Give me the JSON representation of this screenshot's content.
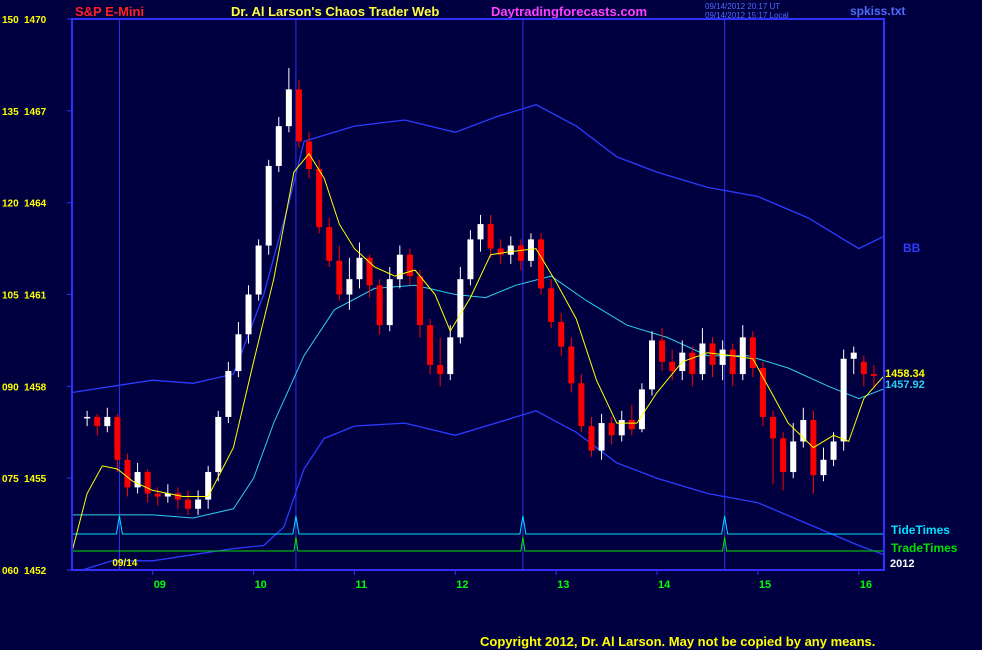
{
  "header": {
    "symbol": "S&P E-Mini",
    "title": "Dr. Al Larson's Chaos Trader Web",
    "site": "Daytradingforecasts.com",
    "timestamp_utc": "09/14/2012 20:17 UT",
    "timestamp_local": "09/14/2012 15:17 Local",
    "file": "spkiss.txt"
  },
  "footer": {
    "copyright": "Copyright 2012, Dr. Al Larson. May not be copied by any means."
  },
  "colors": {
    "background": "#000040",
    "frame": "#3030ff",
    "up_candle": "#ffffff",
    "down_candle": "#ff0000",
    "band": "#2a3cff",
    "mid": "#2ad0f0",
    "fast": "#ffff00",
    "tide": "#00e0ff",
    "trade": "#00e000",
    "time_label": "#00ff00"
  },
  "chart_data": {
    "type": "candlestick",
    "ylim": [
      1452,
      1470
    ],
    "xlim": [
      8.2,
      16.25
    ],
    "y_ticks": [
      {
        "left": "060",
        "value": 1452
      },
      {
        "left": "075",
        "value": 1455
      },
      {
        "left": "090",
        "value": 1458
      },
      {
        "left": "105",
        "value": 1461
      },
      {
        "left": "120",
        "value": 1464
      },
      {
        "left": "135",
        "value": 1467
      },
      {
        "left": "150",
        "value": 1470
      }
    ],
    "x_ticks": [
      {
        "label": "09",
        "x": 9
      },
      {
        "label": "10",
        "x": 10
      },
      {
        "label": "11",
        "x": 11
      },
      {
        "label": "12",
        "x": 12
      },
      {
        "label": "13",
        "x": 13
      },
      {
        "label": "14",
        "x": 14
      },
      {
        "label": "15",
        "x": 15
      },
      {
        "label": "16",
        "x": 16
      }
    ],
    "date_label": "09/14",
    "date_label_x": 8.6,
    "year_label": "2012",
    "vertical_lines": [
      8.67,
      10.42,
      12.67,
      14.67
    ],
    "tide_times": {
      "label": "TideTimes",
      "spikes": [
        8.67,
        10.42,
        12.67,
        14.67
      ]
    },
    "trade_times": {
      "label": "TradeTimes",
      "spikes": [
        10.42,
        12.67,
        14.67
      ]
    },
    "band_label": "BB",
    "last_values": [
      {
        "value": 1458.34,
        "label": "1458.34",
        "series": "fast"
      },
      {
        "value": 1457.92,
        "label": "1457.92",
        "series": "mid"
      }
    ],
    "candles": [
      [
        8.35,
        1457.0,
        1457.0,
        1457.2,
        1456.7
      ],
      [
        8.45,
        1457.0,
        1456.7,
        1457.1,
        1456.4
      ],
      [
        8.55,
        1456.7,
        1457.0,
        1457.3,
        1456.5
      ],
      [
        8.65,
        1457.0,
        1455.6,
        1457.1,
        1455.2
      ],
      [
        8.75,
        1455.6,
        1454.7,
        1455.8,
        1454.4
      ],
      [
        8.85,
        1454.7,
        1455.2,
        1455.5,
        1454.5
      ],
      [
        8.95,
        1455.2,
        1454.5,
        1455.3,
        1454.2
      ],
      [
        9.05,
        1454.5,
        1454.4,
        1454.7,
        1454.1
      ],
      [
        9.15,
        1454.4,
        1454.5,
        1454.8,
        1454.2
      ],
      [
        9.25,
        1454.5,
        1454.3,
        1454.7,
        1454.0
      ],
      [
        9.35,
        1454.3,
        1454.0,
        1454.6,
        1453.8
      ],
      [
        9.45,
        1454.0,
        1454.3,
        1454.6,
        1453.8
      ],
      [
        9.55,
        1454.3,
        1455.2,
        1455.4,
        1454.0
      ],
      [
        9.65,
        1455.2,
        1457.0,
        1457.2,
        1454.9
      ],
      [
        9.75,
        1457.0,
        1458.5,
        1458.8,
        1456.8
      ],
      [
        9.85,
        1458.5,
        1459.7,
        1460.1,
        1458.3
      ],
      [
        9.95,
        1459.7,
        1461.0,
        1461.3,
        1459.4
      ],
      [
        10.05,
        1461.0,
        1462.6,
        1462.8,
        1460.8
      ],
      [
        10.15,
        1462.6,
        1465.2,
        1465.4,
        1462.3
      ],
      [
        10.25,
        1465.2,
        1466.5,
        1466.8,
        1465.0
      ],
      [
        10.35,
        1466.5,
        1467.7,
        1468.4,
        1466.3
      ],
      [
        10.45,
        1467.7,
        1466.0,
        1468.0,
        1465.8
      ],
      [
        10.55,
        1466.0,
        1465.1,
        1466.3,
        1464.8
      ],
      [
        10.65,
        1465.1,
        1463.2,
        1465.4,
        1463.0
      ],
      [
        10.75,
        1463.2,
        1462.1,
        1463.5,
        1461.9
      ],
      [
        10.85,
        1462.1,
        1461.0,
        1462.6,
        1460.8
      ],
      [
        10.95,
        1461.0,
        1461.5,
        1462.2,
        1460.5
      ],
      [
        11.05,
        1461.5,
        1462.2,
        1462.7,
        1461.2
      ],
      [
        11.15,
        1462.2,
        1461.3,
        1462.3,
        1460.9
      ],
      [
        11.25,
        1461.3,
        1460.0,
        1461.5,
        1459.7
      ],
      [
        11.35,
        1460.0,
        1461.5,
        1461.9,
        1459.8
      ],
      [
        11.45,
        1461.5,
        1462.3,
        1462.6,
        1461.2
      ],
      [
        11.55,
        1462.3,
        1461.6,
        1462.5,
        1461.3
      ],
      [
        11.65,
        1461.6,
        1460.0,
        1461.8,
        1459.6
      ],
      [
        11.75,
        1460.0,
        1458.7,
        1460.2,
        1458.4
      ],
      [
        11.85,
        1458.7,
        1458.4,
        1459.6,
        1458.0
      ],
      [
        11.95,
        1458.4,
        1459.6,
        1460.0,
        1458.2
      ],
      [
        12.05,
        1459.6,
        1461.5,
        1461.9,
        1459.4
      ],
      [
        12.15,
        1461.5,
        1462.8,
        1463.1,
        1461.3
      ],
      [
        12.25,
        1462.8,
        1463.3,
        1463.6,
        1462.4
      ],
      [
        12.35,
        1463.3,
        1462.5,
        1463.6,
        1462.2
      ],
      [
        12.45,
        1462.5,
        1462.3,
        1462.8,
        1462.0
      ],
      [
        12.55,
        1462.3,
        1462.6,
        1462.9,
        1462.0
      ],
      [
        12.65,
        1462.6,
        1462.1,
        1462.8,
        1461.8
      ],
      [
        12.75,
        1462.1,
        1462.8,
        1463.0,
        1461.9
      ],
      [
        12.85,
        1462.8,
        1461.2,
        1463.0,
        1461.0
      ],
      [
        12.95,
        1461.2,
        1460.1,
        1461.5,
        1459.9
      ],
      [
        13.05,
        1460.1,
        1459.3,
        1460.4,
        1459.0
      ],
      [
        13.15,
        1459.3,
        1458.1,
        1459.6,
        1457.8
      ],
      [
        13.25,
        1458.1,
        1456.7,
        1458.4,
        1456.5
      ],
      [
        13.35,
        1456.7,
        1455.9,
        1457.0,
        1455.7
      ],
      [
        13.45,
        1455.9,
        1456.8,
        1457.1,
        1455.6
      ],
      [
        13.55,
        1456.8,
        1456.4,
        1457.0,
        1456.1
      ],
      [
        13.65,
        1456.4,
        1456.9,
        1457.2,
        1456.2
      ],
      [
        13.75,
        1456.9,
        1456.6,
        1457.4,
        1456.4
      ],
      [
        13.85,
        1456.6,
        1457.9,
        1458.1,
        1456.5
      ],
      [
        13.95,
        1457.9,
        1459.5,
        1459.8,
        1457.7
      ],
      [
        14.05,
        1459.5,
        1458.8,
        1459.9,
        1458.5
      ],
      [
        14.15,
        1458.8,
        1458.5,
        1459.2,
        1458.2
      ],
      [
        14.25,
        1458.5,
        1459.1,
        1459.5,
        1458.2
      ],
      [
        14.35,
        1459.1,
        1458.4,
        1459.3,
        1458.0
      ],
      [
        14.45,
        1458.4,
        1459.4,
        1459.9,
        1458.2
      ],
      [
        14.55,
        1459.4,
        1458.7,
        1459.6,
        1458.3
      ],
      [
        14.65,
        1458.7,
        1459.2,
        1459.5,
        1458.2
      ],
      [
        14.75,
        1459.2,
        1458.4,
        1459.4,
        1458.0
      ],
      [
        14.85,
        1458.4,
        1459.6,
        1460.0,
        1458.2
      ],
      [
        14.95,
        1459.6,
        1458.6,
        1459.8,
        1458.3
      ],
      [
        15.05,
        1458.6,
        1457.0,
        1458.8,
        1456.7
      ],
      [
        15.15,
        1457.0,
        1456.3,
        1457.2,
        1454.8
      ],
      [
        15.25,
        1456.3,
        1455.2,
        1456.5,
        1454.6
      ],
      [
        15.35,
        1455.2,
        1456.2,
        1456.8,
        1455.0
      ],
      [
        15.45,
        1456.2,
        1456.9,
        1457.3,
        1456.0
      ],
      [
        15.55,
        1456.9,
        1455.1,
        1457.2,
        1454.5
      ],
      [
        15.65,
        1455.1,
        1455.6,
        1456.0,
        1454.9
      ],
      [
        15.75,
        1455.6,
        1456.2,
        1456.5,
        1455.4
      ],
      [
        15.85,
        1456.2,
        1458.9,
        1459.2,
        1455.9
      ],
      [
        15.95,
        1458.9,
        1459.1,
        1459.3,
        1458.4
      ],
      [
        16.05,
        1458.8,
        1458.4,
        1459.0,
        1458.0
      ],
      [
        16.15,
        1458.4,
        1458.34,
        1458.7,
        1458.0
      ]
    ],
    "series": {
      "upper_band": [
        [
          8.2,
          1457.8
        ],
        [
          8.6,
          1458.0
        ],
        [
          9.0,
          1458.2
        ],
        [
          9.4,
          1458.1
        ],
        [
          9.8,
          1458.4
        ],
        [
          10.1,
          1461.0
        ],
        [
          10.35,
          1464.0
        ],
        [
          10.5,
          1466.0
        ],
        [
          10.7,
          1466.2
        ],
        [
          11.0,
          1466.5
        ],
        [
          11.5,
          1466.7
        ],
        [
          12.0,
          1466.3
        ],
        [
          12.4,
          1466.8
        ],
        [
          12.8,
          1467.2
        ],
        [
          13.2,
          1466.5
        ],
        [
          13.6,
          1465.5
        ],
        [
          14.0,
          1465.0
        ],
        [
          14.5,
          1464.5
        ],
        [
          15.0,
          1464.2
        ],
        [
          15.5,
          1463.5
        ],
        [
          16.0,
          1462.5
        ],
        [
          16.25,
          1462.9
        ]
      ],
      "lower_band": [
        [
          8.3,
          1452.0
        ],
        [
          8.6,
          1452.3
        ],
        [
          9.0,
          1452.3
        ],
        [
          9.4,
          1452.5
        ],
        [
          9.8,
          1452.7
        ],
        [
          10.1,
          1452.8
        ],
        [
          10.3,
          1453.4
        ],
        [
          10.5,
          1455.3
        ],
        [
          10.7,
          1456.3
        ],
        [
          11.0,
          1456.7
        ],
        [
          11.5,
          1456.8
        ],
        [
          12.0,
          1456.4
        ],
        [
          12.4,
          1456.8
        ],
        [
          12.8,
          1457.2
        ],
        [
          13.2,
          1456.5
        ],
        [
          13.6,
          1455.5
        ],
        [
          14.0,
          1455.0
        ],
        [
          14.5,
          1454.5
        ],
        [
          15.0,
          1454.2
        ],
        [
          15.5,
          1453.5
        ],
        [
          16.0,
          1452.8
        ],
        [
          16.25,
          1452.5
        ]
      ],
      "mid_line": [
        [
          8.2,
          1453.8
        ],
        [
          8.6,
          1453.8
        ],
        [
          9.0,
          1453.8
        ],
        [
          9.4,
          1453.7
        ],
        [
          9.8,
          1454.0
        ],
        [
          10.0,
          1455.0
        ],
        [
          10.2,
          1456.8
        ],
        [
          10.5,
          1459.0
        ],
        [
          10.8,
          1460.5
        ],
        [
          11.2,
          1461.2
        ],
        [
          11.6,
          1461.3
        ],
        [
          12.0,
          1461.0
        ],
        [
          12.3,
          1460.9
        ],
        [
          12.6,
          1461.3
        ],
        [
          12.95,
          1461.6
        ],
        [
          13.3,
          1460.8
        ],
        [
          13.7,
          1460.0
        ],
        [
          14.1,
          1459.6
        ],
        [
          14.5,
          1459.0
        ],
        [
          14.9,
          1459.0
        ],
        [
          15.3,
          1458.6
        ],
        [
          15.7,
          1458.0
        ],
        [
          16.0,
          1457.6
        ],
        [
          16.25,
          1457.92
        ]
      ],
      "fast_line": [
        [
          8.2,
          1452.6
        ],
        [
          8.35,
          1454.5
        ],
        [
          8.5,
          1455.4
        ],
        [
          8.65,
          1455.3
        ],
        [
          8.8,
          1454.9
        ],
        [
          9.0,
          1454.6
        ],
        [
          9.3,
          1454.4
        ],
        [
          9.55,
          1454.4
        ],
        [
          9.8,
          1456.0
        ],
        [
          10.0,
          1458.8
        ],
        [
          10.2,
          1461.5
        ],
        [
          10.4,
          1465.0
        ],
        [
          10.55,
          1465.6
        ],
        [
          10.7,
          1464.8
        ],
        [
          10.85,
          1463.3
        ],
        [
          11.0,
          1462.5
        ],
        [
          11.2,
          1461.9
        ],
        [
          11.4,
          1461.6
        ],
        [
          11.6,
          1461.8
        ],
        [
          11.8,
          1461.0
        ],
        [
          11.95,
          1459.8
        ],
        [
          12.15,
          1460.9
        ],
        [
          12.35,
          1462.3
        ],
        [
          12.55,
          1462.4
        ],
        [
          12.8,
          1462.5
        ],
        [
          13.0,
          1461.4
        ],
        [
          13.2,
          1460.2
        ],
        [
          13.4,
          1458.2
        ],
        [
          13.6,
          1456.8
        ],
        [
          13.8,
          1456.8
        ],
        [
          14.0,
          1457.8
        ],
        [
          14.25,
          1458.8
        ],
        [
          14.5,
          1459.1
        ],
        [
          14.75,
          1459.0
        ],
        [
          14.95,
          1458.9
        ],
        [
          15.1,
          1458.0
        ],
        [
          15.3,
          1456.8
        ],
        [
          15.55,
          1456.0
        ],
        [
          15.75,
          1456.4
        ],
        [
          15.9,
          1456.2
        ],
        [
          16.05,
          1457.6
        ],
        [
          16.25,
          1458.34
        ]
      ]
    }
  }
}
